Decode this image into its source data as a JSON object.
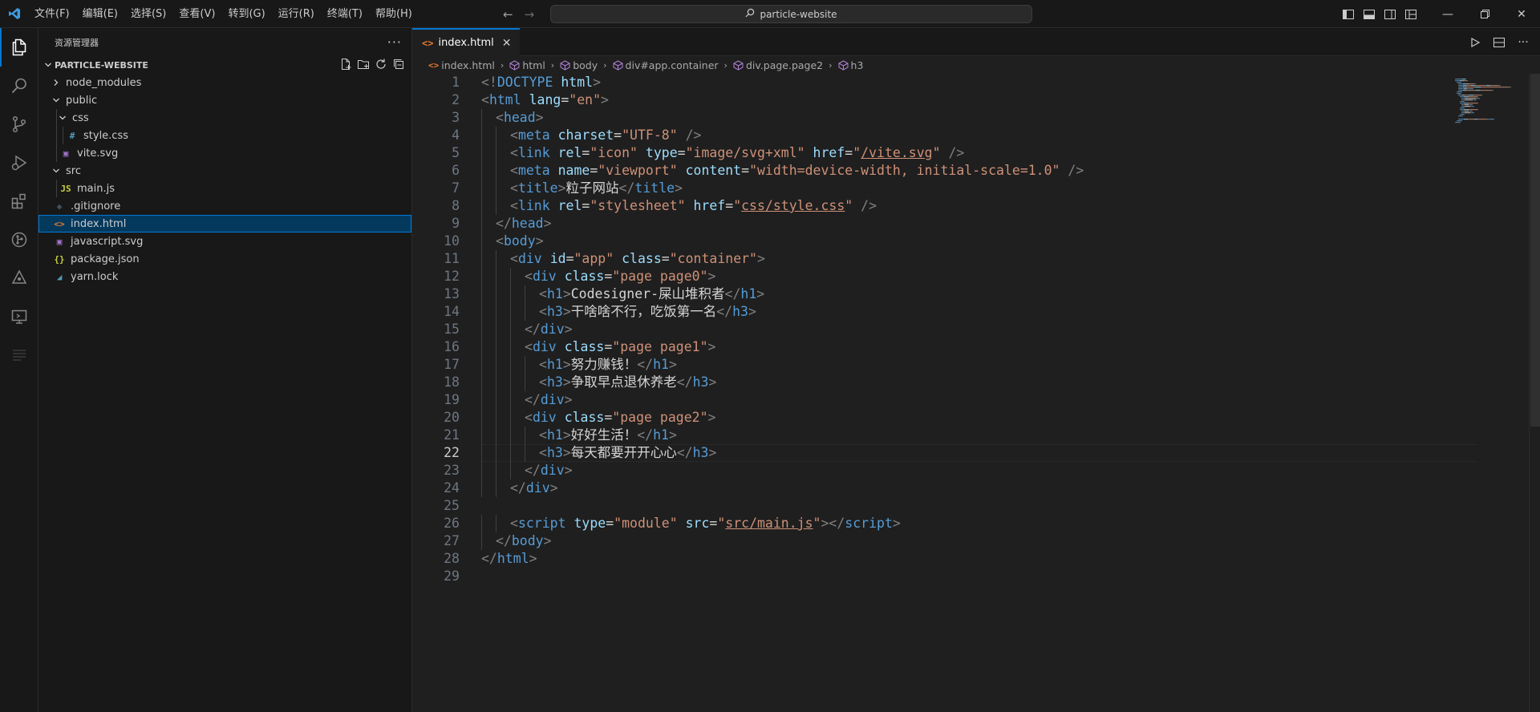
{
  "menu": [
    "文件(F)",
    "编辑(E)",
    "选择(S)",
    "查看(V)",
    "转到(G)",
    "运行(R)",
    "终端(T)",
    "帮助(H)"
  ],
  "command_center": {
    "text": "particle-website",
    "icon": "search-icon"
  },
  "window_controls": [
    "minimize",
    "restore",
    "close"
  ],
  "explorer": {
    "title": "资源管理器",
    "more": "···",
    "folder": "PARTICLE-WEBSITE",
    "tree": [
      {
        "label": "node_modules",
        "kind": "folder",
        "expanded": false,
        "depth": 0
      },
      {
        "label": "public",
        "kind": "folder",
        "expanded": true,
        "depth": 0
      },
      {
        "label": "css",
        "kind": "folder",
        "expanded": true,
        "depth": 1
      },
      {
        "label": "style.css",
        "kind": "css",
        "depth": 2
      },
      {
        "label": "vite.svg",
        "kind": "svg",
        "depth": 1
      },
      {
        "label": "src",
        "kind": "folder",
        "expanded": true,
        "depth": 0
      },
      {
        "label": "main.js",
        "kind": "js",
        "depth": 1
      },
      {
        "label": ".gitignore",
        "kind": "git",
        "depth": 0
      },
      {
        "label": "index.html",
        "kind": "html",
        "depth": 0,
        "selected": true
      },
      {
        "label": "javascript.svg",
        "kind": "svg",
        "depth": 0
      },
      {
        "label": "package.json",
        "kind": "json",
        "depth": 0
      },
      {
        "label": "yarn.lock",
        "kind": "yarn",
        "depth": 0
      }
    ]
  },
  "tabs": [
    {
      "label": "index.html",
      "active": true
    }
  ],
  "breadcrumb": [
    "index.html",
    "html",
    "body",
    "div#app.container",
    "div.page.page2",
    "h3"
  ],
  "editor": {
    "current_line": 22,
    "lines": [
      {
        "n": "1",
        "indent": 0,
        "tokens": [
          [
            "br",
            "<!"
          ],
          [
            "tag",
            "DOCTYPE "
          ],
          [
            "attr",
            "html"
          ],
          [
            "br",
            ">"
          ]
        ]
      },
      {
        "n": "2",
        "indent": 0,
        "tokens": [
          [
            "br",
            "<"
          ],
          [
            "tag",
            "html "
          ],
          [
            "attr",
            "lang"
          ],
          [
            "txt",
            "="
          ],
          [
            "str",
            "\"en\""
          ],
          [
            "br",
            ">"
          ]
        ]
      },
      {
        "n": "3",
        "indent": 1,
        "tokens": [
          [
            "br",
            "<"
          ],
          [
            "tag",
            "head"
          ],
          [
            "br",
            ">"
          ]
        ]
      },
      {
        "n": "4",
        "indent": 2,
        "tokens": [
          [
            "br",
            "<"
          ],
          [
            "tag",
            "meta "
          ],
          [
            "attr",
            "charset"
          ],
          [
            "txt",
            "="
          ],
          [
            "str",
            "\"UTF-8\""
          ],
          [
            "br",
            " />"
          ]
        ]
      },
      {
        "n": "5",
        "indent": 2,
        "tokens": [
          [
            "br",
            "<"
          ],
          [
            "tag",
            "link "
          ],
          [
            "attr",
            "rel"
          ],
          [
            "txt",
            "="
          ],
          [
            "str",
            "\"icon\" "
          ],
          [
            "attr",
            "type"
          ],
          [
            "txt",
            "="
          ],
          [
            "str",
            "\"image/svg+xml\" "
          ],
          [
            "attr",
            "href"
          ],
          [
            "txt",
            "="
          ],
          [
            "str",
            "\""
          ],
          [
            "link",
            "/vite.svg"
          ],
          [
            "str",
            "\""
          ],
          [
            "br",
            " />"
          ]
        ]
      },
      {
        "n": "6",
        "indent": 2,
        "tokens": [
          [
            "br",
            "<"
          ],
          [
            "tag",
            "meta "
          ],
          [
            "attr",
            "name"
          ],
          [
            "txt",
            "="
          ],
          [
            "str",
            "\"viewport\" "
          ],
          [
            "attr",
            "content"
          ],
          [
            "txt",
            "="
          ],
          [
            "str",
            "\"width=device-width, initial-scale=1.0\""
          ],
          [
            "br",
            " />"
          ]
        ]
      },
      {
        "n": "7",
        "indent": 2,
        "tokens": [
          [
            "br",
            "<"
          ],
          [
            "tag",
            "title"
          ],
          [
            "br",
            ">"
          ],
          [
            "txt",
            "粒子网站"
          ],
          [
            "br",
            "</"
          ],
          [
            "tag",
            "title"
          ],
          [
            "br",
            ">"
          ]
        ]
      },
      {
        "n": "8",
        "indent": 2,
        "tokens": [
          [
            "br",
            "<"
          ],
          [
            "tag",
            "link "
          ],
          [
            "attr",
            "rel"
          ],
          [
            "txt",
            "="
          ],
          [
            "str",
            "\"stylesheet\" "
          ],
          [
            "attr",
            "href"
          ],
          [
            "txt",
            "="
          ],
          [
            "str",
            "\""
          ],
          [
            "link",
            "css/style.css"
          ],
          [
            "str",
            "\""
          ],
          [
            "br",
            " />"
          ]
        ]
      },
      {
        "n": "9",
        "indent": 1,
        "tokens": [
          [
            "br",
            "</"
          ],
          [
            "tag",
            "head"
          ],
          [
            "br",
            ">"
          ]
        ]
      },
      {
        "n": "10",
        "indent": 1,
        "tokens": [
          [
            "br",
            "<"
          ],
          [
            "tag",
            "body"
          ],
          [
            "br",
            ">"
          ]
        ]
      },
      {
        "n": "11",
        "indent": 2,
        "tokens": [
          [
            "br",
            "<"
          ],
          [
            "tag",
            "div "
          ],
          [
            "attr",
            "id"
          ],
          [
            "txt",
            "="
          ],
          [
            "str",
            "\"app\" "
          ],
          [
            "attr",
            "class"
          ],
          [
            "txt",
            "="
          ],
          [
            "str",
            "\"container\""
          ],
          [
            "br",
            ">"
          ]
        ]
      },
      {
        "n": "12",
        "indent": 3,
        "tokens": [
          [
            "br",
            "<"
          ],
          [
            "tag",
            "div "
          ],
          [
            "attr",
            "class"
          ],
          [
            "txt",
            "="
          ],
          [
            "str",
            "\"page page0\""
          ],
          [
            "br",
            ">"
          ]
        ]
      },
      {
        "n": "13",
        "indent": 4,
        "tokens": [
          [
            "br",
            "<"
          ],
          [
            "tag",
            "h1"
          ],
          [
            "br",
            ">"
          ],
          [
            "txt",
            "Codesigner-屎山堆积者"
          ],
          [
            "br",
            "</"
          ],
          [
            "tag",
            "h1"
          ],
          [
            "br",
            ">"
          ]
        ]
      },
      {
        "n": "14",
        "indent": 4,
        "tokens": [
          [
            "br",
            "<"
          ],
          [
            "tag",
            "h3"
          ],
          [
            "br",
            ">"
          ],
          [
            "txt",
            "干啥啥不行，吃饭第一名"
          ],
          [
            "br",
            "</"
          ],
          [
            "tag",
            "h3"
          ],
          [
            "br",
            ">"
          ]
        ]
      },
      {
        "n": "15",
        "indent": 3,
        "tokens": [
          [
            "br",
            "</"
          ],
          [
            "tag",
            "div"
          ],
          [
            "br",
            ">"
          ]
        ]
      },
      {
        "n": "16",
        "indent": 3,
        "tokens": [
          [
            "br",
            "<"
          ],
          [
            "tag",
            "div "
          ],
          [
            "attr",
            "class"
          ],
          [
            "txt",
            "="
          ],
          [
            "str",
            "\"page page1\""
          ],
          [
            "br",
            ">"
          ]
        ]
      },
      {
        "n": "17",
        "indent": 4,
        "tokens": [
          [
            "br",
            "<"
          ],
          [
            "tag",
            "h1"
          ],
          [
            "br",
            ">"
          ],
          [
            "txt",
            "努力赚钱！"
          ],
          [
            "br",
            "</"
          ],
          [
            "tag",
            "h1"
          ],
          [
            "br",
            ">"
          ]
        ]
      },
      {
        "n": "18",
        "indent": 4,
        "tokens": [
          [
            "br",
            "<"
          ],
          [
            "tag",
            "h3"
          ],
          [
            "br",
            ">"
          ],
          [
            "txt",
            "争取早点退休养老"
          ],
          [
            "br",
            "</"
          ],
          [
            "tag",
            "h3"
          ],
          [
            "br",
            ">"
          ]
        ]
      },
      {
        "n": "19",
        "indent": 3,
        "tokens": [
          [
            "br",
            "</"
          ],
          [
            "tag",
            "div"
          ],
          [
            "br",
            ">"
          ]
        ]
      },
      {
        "n": "20",
        "indent": 3,
        "tokens": [
          [
            "br",
            "<"
          ],
          [
            "tag",
            "div "
          ],
          [
            "attr",
            "class"
          ],
          [
            "txt",
            "="
          ],
          [
            "str",
            "\"page page2\""
          ],
          [
            "br",
            ">"
          ]
        ]
      },
      {
        "n": "21",
        "indent": 4,
        "tokens": [
          [
            "br",
            "<"
          ],
          [
            "tag",
            "h1"
          ],
          [
            "br",
            ">"
          ],
          [
            "txt",
            "好好生活！"
          ],
          [
            "br",
            "</"
          ],
          [
            "tag",
            "h1"
          ],
          [
            "br",
            ">"
          ]
        ]
      },
      {
        "n": "22",
        "indent": 4,
        "tokens": [
          [
            "br",
            "<"
          ],
          [
            "tag",
            "h3"
          ],
          [
            "br",
            ">"
          ],
          [
            "txt",
            "每天都要开开心心"
          ],
          [
            "br",
            "</"
          ],
          [
            "tag",
            "h3"
          ],
          [
            "br",
            ">"
          ]
        ]
      },
      {
        "n": "23",
        "indent": 3,
        "tokens": [
          [
            "br",
            "</"
          ],
          [
            "tag",
            "div"
          ],
          [
            "br",
            ">"
          ]
        ]
      },
      {
        "n": "24",
        "indent": 2,
        "tokens": [
          [
            "br",
            "</"
          ],
          [
            "tag",
            "div"
          ],
          [
            "br",
            ">"
          ]
        ]
      },
      {
        "n": "25",
        "indent": 0,
        "tokens": []
      },
      {
        "n": "26",
        "indent": 2,
        "tokens": [
          [
            "br",
            "<"
          ],
          [
            "tag",
            "script "
          ],
          [
            "attr",
            "type"
          ],
          [
            "txt",
            "="
          ],
          [
            "str",
            "\"module\" "
          ],
          [
            "attr",
            "src"
          ],
          [
            "txt",
            "="
          ],
          [
            "str",
            "\""
          ],
          [
            "link",
            "src/main.js"
          ],
          [
            "str",
            "\""
          ],
          [
            "br",
            "></"
          ],
          [
            "tag",
            "script"
          ],
          [
            "br",
            ">"
          ]
        ]
      },
      {
        "n": "27",
        "indent": 1,
        "tokens": [
          [
            "br",
            "</"
          ],
          [
            "tag",
            "body"
          ],
          [
            "br",
            ">"
          ]
        ]
      },
      {
        "n": "28",
        "indent": 0,
        "tokens": [
          [
            "br",
            "</"
          ],
          [
            "tag",
            "html"
          ],
          [
            "br",
            ">"
          ]
        ]
      },
      {
        "n": "29",
        "indent": 0,
        "tokens": []
      }
    ]
  },
  "colors": {
    "accent": "#0078d4",
    "selection": "#04395e",
    "tag": "#569cd6",
    "attr": "#9cdcfe",
    "string": "#ce9178"
  }
}
